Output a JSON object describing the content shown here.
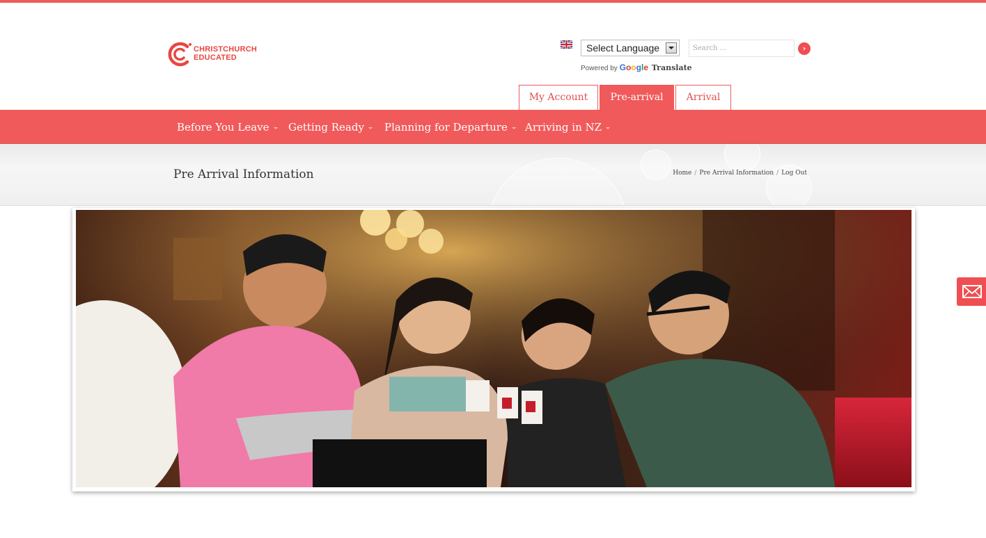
{
  "brand": {
    "line1": "CHRISTCHURCH",
    "line2": "EDUCATED"
  },
  "language": {
    "selected": "Select Language",
    "powered_by": "Powered by",
    "google": "Google",
    "translate": "Translate"
  },
  "search": {
    "placeholder": "Search ...",
    "button_icon": "chevron-right-icon"
  },
  "tabs": [
    {
      "label": "My Account",
      "active": false
    },
    {
      "label": "Pre-arrival",
      "active": true
    },
    {
      "label": "Arrival",
      "active": false
    }
  ],
  "nav": [
    {
      "label": "Before You Leave"
    },
    {
      "label": "Getting Ready"
    },
    {
      "label": "Planning for Departure"
    },
    {
      "label": "Arriving in NZ"
    }
  ],
  "page_title": "Pre Arrival Information",
  "breadcrumb": [
    "Home",
    "Pre Arrival Information",
    "Log Out"
  ],
  "hero": {
    "alt_icon": "photo-students-cafe"
  },
  "colors": {
    "accent": "#f05a5a",
    "nav_bg": "#f15a5a",
    "logo": "#e8463f"
  },
  "side_button": {
    "icon": "envelope-icon"
  }
}
